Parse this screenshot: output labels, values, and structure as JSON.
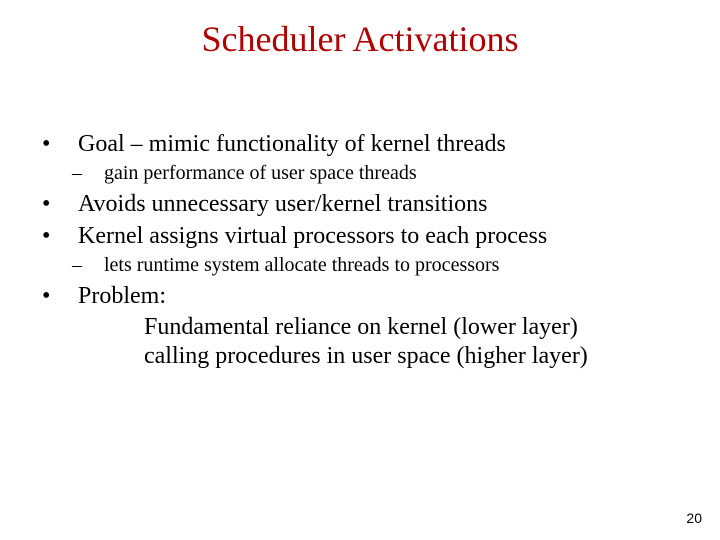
{
  "title": "Scheduler Activations",
  "bullets": {
    "goal": "Goal – mimic functionality of kernel threads",
    "goal_sub": "gain performance of user space threads",
    "avoids": "Avoids unnecessary user/kernel transitions",
    "kernel_assigns": "Kernel assigns virtual processors to each process",
    "kernel_assigns_sub": "lets runtime system allocate threads to processors",
    "problem_label": "Problem:",
    "problem_line1": "Fundamental reliance on kernel (lower layer)",
    "problem_line2": "calling procedures in user space (higher layer)"
  },
  "page_number": "20"
}
